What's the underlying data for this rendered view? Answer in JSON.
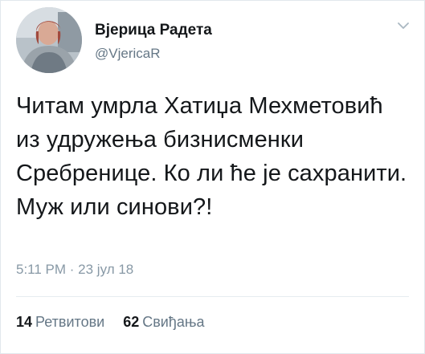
{
  "author": {
    "display_name": "Вјерица Радета",
    "handle": "@VjericaR"
  },
  "tweet": {
    "text": "Читам умрла Хатиџа Мехметовић из удружења бизнисменки Сребренице. Ко ли ће је сахранити. Муж или синови?!",
    "timestamp": "5:11 PM · 23 јул 18"
  },
  "stats": {
    "retweets_count": "14",
    "retweets_label": "Ретвитови",
    "likes_count": "62",
    "likes_label": "Свиђања"
  },
  "icons": {
    "menu": "chevron-down-icon"
  },
  "colors": {
    "text_primary": "#14171a",
    "text_secondary": "#657786",
    "timestamp": "#8899a6",
    "divider": "#e6ecf0"
  }
}
